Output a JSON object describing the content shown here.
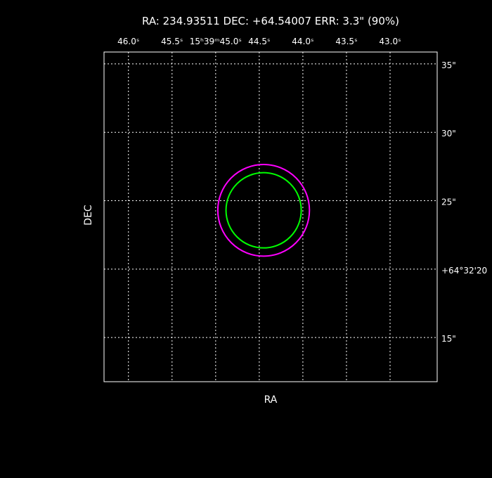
{
  "header": {
    "title": "RA: 234.93511   DEC: +64.54007   ERR: 3.3\" (90%)"
  },
  "colors": {
    "background": "#000000",
    "frame": "#ffffff",
    "grid": "#ffffff",
    "text": "#ffffff",
    "outer_circle": "#ff00ff",
    "inner_circle": "#00ff00"
  },
  "chart_data": {
    "type": "scatter",
    "title": "RA: 234.93511   DEC: +64.54007   ERR: 3.3\" (90%)",
    "xlabel": "RA",
    "ylabel": "DEC",
    "grid": true,
    "x_ticks": [
      {
        "label": "46.0ˢ",
        "value": 46.0
      },
      {
        "label": "45.5ˢ",
        "value": 45.5
      },
      {
        "label": "15ʰ39ᵐ45.0ˢ",
        "value": 45.0
      },
      {
        "label": "44.5ˢ",
        "value": 44.5
      },
      {
        "label": "44.0ˢ",
        "value": 44.0
      },
      {
        "label": "43.5ˢ",
        "value": 43.5
      },
      {
        "label": "43.0ˢ",
        "value": 43.0
      }
    ],
    "x_range": [
      46.28,
      42.46
    ],
    "y_ticks": [
      {
        "label": "35\"",
        "value": 35
      },
      {
        "label": "30\"",
        "value": 30
      },
      {
        "label": "25\"",
        "value": 25
      },
      {
        "label": "+64°32'20",
        "value": 20
      },
      {
        "label": "15\"",
        "value": 15
      }
    ],
    "y_range": [
      11.77,
      35.87
    ],
    "circles": [
      {
        "name": "outer",
        "center_x": 44.45,
        "center_y": 24.3,
        "radius_arcsec": 3.35,
        "color": "#ff00ff"
      },
      {
        "name": "inner",
        "center_x": 44.45,
        "center_y": 24.3,
        "radius_arcsec": 2.75,
        "color": "#00ff00"
      }
    ]
  }
}
